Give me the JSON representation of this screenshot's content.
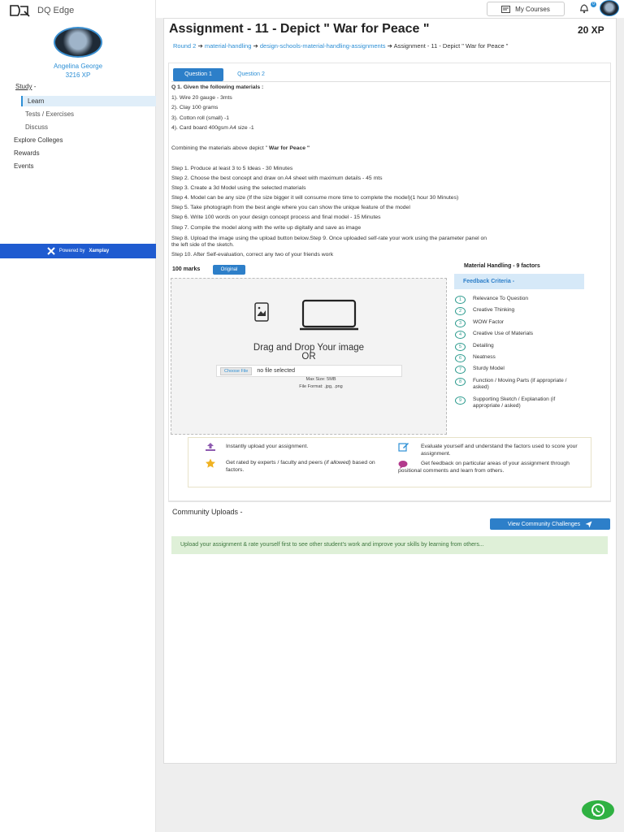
{
  "app": {
    "name": "DQ Edge"
  },
  "user": {
    "name": "Angelina George",
    "xp": "3216 XP"
  },
  "sidebar": {
    "study": "Study",
    "study_suffix": " -",
    "learn": "Learn",
    "tests": "Tests / Exercises",
    "discuss": "Discuss",
    "explore": "Explore Colleges",
    "rewards": "Rewards",
    "events": "Events",
    "powered_prefix": "Powered by",
    "powered_brand": "Xamplay"
  },
  "topbar": {
    "my_courses": "My Courses",
    "notif_count": "0"
  },
  "assignment": {
    "title": "Assignment - 11 - Depict \" War for Peace \"",
    "xp": "20 XP",
    "crumbs": [
      "Round 2",
      "material-handling",
      "design-schools-material-handling-assignments",
      "Assignment - 11 - Depict \" War for Peace \""
    ],
    "tabs": [
      "Question 1",
      "Question 2"
    ],
    "question_heading": "Q 1.  Given the following materials :",
    "materials": [
      "1). Wire 20 gauge - 3mts",
      "2). Clay 100 grams",
      "3). Cotton roll (small) -1",
      "4). Card board 400gsm A4 size -1"
    ],
    "combine_text": "Combining the materials above depict \"",
    "combine_bold": " War for Peace \"",
    "steps": [
      "Step 1. Produce at least 3 to 5 Ideas - 30 Minutes",
      "Step 2. Choose the best concept and draw on A4 sheet with maximum details - 45 mts",
      "Step 3. Create a 3d Model using the selected materials",
      "Step 4. Model can be any size (If the size bigger it will consume more time to complete the model)(1 hour 30 Minutes)",
      "Step 5. Take photograph from the best angle where you can show the unique feature of the model",
      "Step 6. Write 100 words on your design concept process and final model - 15 Minutes",
      "Step 7. Compile the model along with the write up digitally and save as image",
      "Step 8. Upload the image using the upload button below.Step 9. Once uploaded self-rate your work using the parameter panel on",
      "the left side of the sketch.",
      "Step 10. After Self-evaluation, correct any two of your friends work"
    ],
    "marks": "100 marks",
    "original_label": "Original"
  },
  "upload": {
    "title_line1": "Drag and Drop Your image",
    "title_line2": "OR",
    "choose_file": "Choose File",
    "no_file": "no file selected",
    "max_size": "Max Size: 5MB",
    "file_format": "File Format: .jpg, .png"
  },
  "criteria": {
    "heading": "Material Handling - 9 factors",
    "box_label": "Feedback Criteria -",
    "items": [
      "Relevance To Question",
      "Creative Thinking",
      "WOW Factor",
      "Creative Use of Materials",
      "Detailing",
      "Neatness",
      "Sturdy Model",
      "Function / Moving Parts (if appropriate / asked)",
      "Supporting Sketch / Explanation (if appropriate / asked)"
    ]
  },
  "info": {
    "upload_text": "Instantly upload your assignment.",
    "rated_text": "Get rated by experts / faculty and peers (",
    "rated_italic": "if allowed)",
    "rated_suffix": " based on factors.",
    "evaluate_text": "Evaluate yourself and understand the factors used to score your assignment.",
    "feedback_text": "Get feedback on particular areas of your assignment through positional comments and learn from others."
  },
  "community": {
    "heading": "Community Uploads -",
    "button": "View Community Challenges",
    "message": "Upload your assignment & rate yourself first to see other student's work and improve your skills by learning from others..."
  },
  "colors": {
    "accent": "#2d7fc9",
    "link": "#2d8fd5",
    "success_bg": "#dff0d8",
    "whatsapp": "#2fb142",
    "powered_bg": "#1f5bd0"
  }
}
